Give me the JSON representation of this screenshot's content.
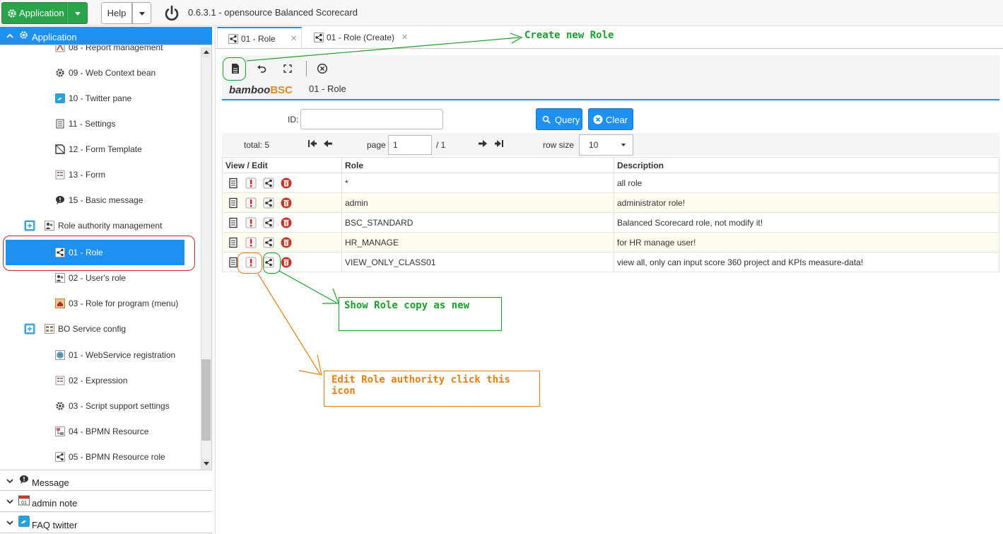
{
  "topbar": {
    "app_label": "Application",
    "help_label": "Help",
    "version_title": "0.6.3.1 - opensource Balanced Scorecard"
  },
  "sidebar": {
    "active_section": "Application",
    "items": [
      {
        "label": "08 - Report management",
        "icon": "report-icon"
      },
      {
        "label": "09 - Web Context bean",
        "icon": "gear-icon"
      },
      {
        "label": "10 - Twitter pane",
        "icon": "twitter-icon"
      },
      {
        "label": "11 - Settings",
        "icon": "settings-icon"
      },
      {
        "label": "12 - Form Template",
        "icon": "form-template-icon"
      },
      {
        "label": "13 - Form",
        "icon": "form-icon"
      },
      {
        "label": "15 - Basic message",
        "icon": "message-icon"
      }
    ],
    "group_role": "Role authority management",
    "role_items": [
      {
        "label": "01 - Role",
        "icon": "share-icon"
      },
      {
        "label": "02 - User's role",
        "icon": "user-icon"
      },
      {
        "label": "03 - Role for program (menu)",
        "icon": "home-icon"
      }
    ],
    "group_bo": "BO Service config",
    "bo_items": [
      {
        "label": "01 - WebService registration",
        "icon": "globe-icon"
      },
      {
        "label": "02 - Expression",
        "icon": "form-icon"
      },
      {
        "label": "03 - Script support settings",
        "icon": "gear-icon"
      },
      {
        "label": "04 - BPMN Resource",
        "icon": "bpmn-icon"
      },
      {
        "label": "05 - BPMN Resource role",
        "icon": "share-icon"
      }
    ],
    "sections": [
      "Message",
      "admin note",
      "FAQ twitter"
    ]
  },
  "tabs": [
    {
      "label": "01 - Role"
    },
    {
      "label": "01 - Role (Create)"
    }
  ],
  "header": {
    "brand_main": "bamboo",
    "brand_accent": "BSC",
    "page_title": "01 - Role"
  },
  "query": {
    "id_label": "ID:",
    "query_button": "Query",
    "clear_button": "Clear"
  },
  "pager": {
    "total": "total: 5",
    "page_label": "page",
    "page_value": "1",
    "page_total": "/ 1",
    "row_size_label": "row size",
    "row_size_value": "10"
  },
  "grid": {
    "columns": [
      "View / Edit",
      "Role",
      "Description"
    ],
    "rows": [
      {
        "role": "*",
        "description": "all role"
      },
      {
        "role": "admin",
        "description": "administrator role!"
      },
      {
        "role": "BSC_STANDARD",
        "description": "Balanced Scorecard role, not modify it!"
      },
      {
        "role": "HR_MANAGE",
        "description": "for HR manage user!"
      },
      {
        "role": "VIEW_ONLY_CLASS01",
        "description": "view all, only can input score 360 project and KPIs measure-data!"
      }
    ]
  },
  "annotations": {
    "create_new": "Create new Role",
    "show_copy": "Show Role copy as new",
    "edit_authority_line1": "Edit Role authority click this",
    "edit_authority_line2": "icon"
  },
  "colors": {
    "accent_blue": "#1e90ef",
    "app_green": "#2aa34a",
    "brand_orange": "#e58a1f",
    "annotation_green": "#1aa02a",
    "annotation_orange": "#e87f0c",
    "highlight_red": "#d3262b"
  }
}
